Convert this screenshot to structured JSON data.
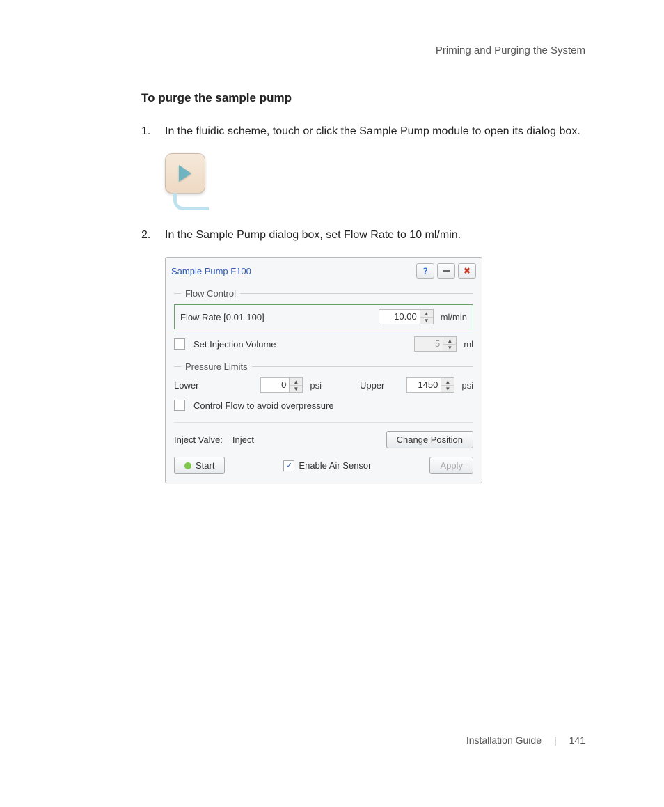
{
  "header": {
    "running": "Priming and Purging the System"
  },
  "section": {
    "title": "To purge the sample pump"
  },
  "steps": {
    "s1": {
      "num": "1.",
      "text": "In the fluidic scheme, touch or click the Sample Pump module to open its dialog box."
    },
    "s2": {
      "num": "2.",
      "text": "In the Sample Pump dialog box, set Flow Rate to 10 ml/min."
    }
  },
  "dialog": {
    "title": "Sample Pump F100",
    "help_glyph": "?",
    "close_glyph": "✖",
    "groups": {
      "flow": {
        "legend": "Flow Control",
        "flow_rate_label": "Flow Rate [0.01-100]",
        "flow_rate_value": "10.00",
        "flow_rate_unit": "ml/min",
        "inj_vol_label": "Set Injection Volume",
        "inj_vol_value": "5",
        "inj_vol_unit": "ml"
      },
      "pressure": {
        "legend": "Pressure Limits",
        "lower_label": "Lower",
        "lower_value": "0",
        "lower_unit": "psi",
        "upper_label": "Upper",
        "upper_value": "1450",
        "upper_unit": "psi",
        "overpressure_label": "Control Flow to avoid overpressure"
      }
    },
    "inject": {
      "label": "Inject Valve:",
      "value": "Inject",
      "change_btn": "Change Position"
    },
    "footer": {
      "start_btn": "Start",
      "enable_air_label": "Enable Air Sensor",
      "apply_btn": "Apply"
    }
  },
  "footer": {
    "guide": "Installation Guide",
    "sep": "|",
    "page": "141"
  }
}
